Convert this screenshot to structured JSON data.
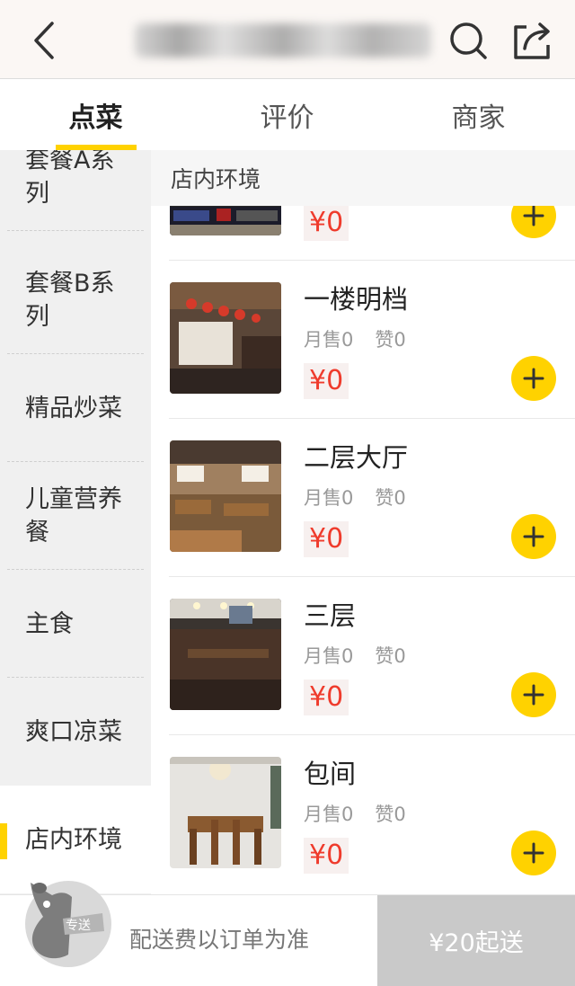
{
  "header": {
    "back_icon": "chevron-left-icon",
    "search_icon": "search-icon",
    "share_icon": "share-icon"
  },
  "tabs": [
    {
      "label": "点菜",
      "active": true
    },
    {
      "label": "评价",
      "active": false
    },
    {
      "label": "商家",
      "active": false
    }
  ],
  "sidebar": {
    "categories": [
      {
        "label": "套餐A系列",
        "active": false
      },
      {
        "label": "套餐B系列",
        "active": false
      },
      {
        "label": "精品炒菜",
        "active": false
      },
      {
        "label": "儿童营养餐",
        "active": false
      },
      {
        "label": "主食",
        "active": false
      },
      {
        "label": "爽口凉菜",
        "active": false
      },
      {
        "label": "店内环境",
        "active": true
      }
    ]
  },
  "section": {
    "title": "店内环境"
  },
  "items": [
    {
      "name": "",
      "sold": "",
      "likes": "",
      "price": "¥0"
    },
    {
      "name": "一楼明档",
      "sold": "月售0",
      "likes": "赞0",
      "price": "¥0"
    },
    {
      "name": "二层大厅",
      "sold": "月售0",
      "likes": "赞0",
      "price": "¥0"
    },
    {
      "name": "三层",
      "sold": "月售0",
      "likes": "赞0",
      "price": "¥0"
    },
    {
      "name": "包间",
      "sold": "月售0",
      "likes": "赞0",
      "price": "¥0"
    }
  ],
  "bottom": {
    "badge": "专送",
    "fee_note": "配送费以订单为准",
    "min_order": "¥20起送"
  },
  "colors": {
    "accent": "#ffd200",
    "price": "#ef3b2c"
  }
}
